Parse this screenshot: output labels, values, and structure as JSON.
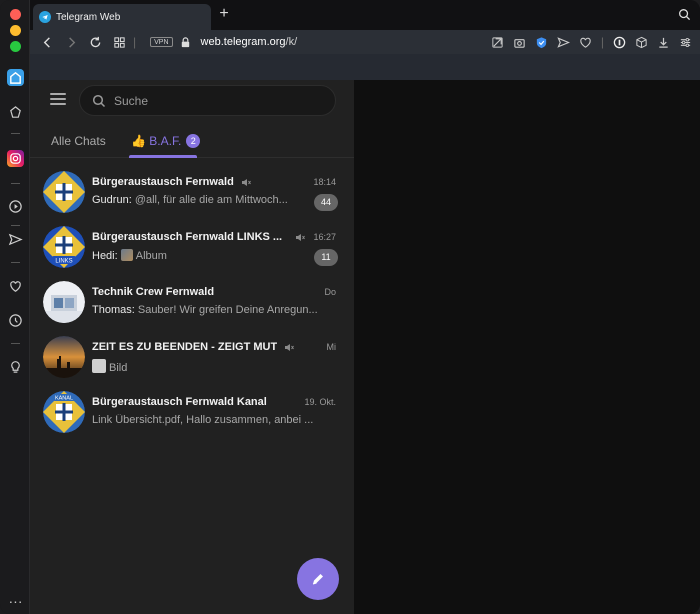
{
  "browser": {
    "tab_title": "Telegram Web",
    "new_tab_label": "+",
    "vpn_label": "VPN",
    "url_host": "web.telegram.org",
    "url_path": "/k/"
  },
  "search": {
    "placeholder": "Suche"
  },
  "folders": {
    "all_chats": "Alle Chats",
    "baf_label": "👍 B.A.F.",
    "baf_count": "2"
  },
  "chats": [
    {
      "name": "Bürgeraustausch Fernwald",
      "time": "18:14",
      "sender": "Gudrun: ",
      "text": "@all, für alle die am Mittwoch...",
      "count": "44",
      "muted": true
    },
    {
      "name": "Bürgeraustausch Fernwald LINKS ...",
      "time": "16:27",
      "sender": "Hedi: ",
      "text": "Album",
      "count": "11",
      "muted": true
    },
    {
      "name": "Technik Crew Fernwald",
      "time": "Do",
      "sender": "Thomas: ",
      "text": "Sauber! Wir greifen Deine Anregun...",
      "count": "",
      "muted": false
    },
    {
      "name": "ZEIT ES ZU BEENDEN - ZEIGT MUT",
      "time": "Mi",
      "sender": "",
      "text": "Bild",
      "count": "",
      "muted": true
    },
    {
      "name": "Bürgeraustausch Fernwald Kanal",
      "time": "19. Okt.",
      "sender": "",
      "text": "Link Übersicht.pdf, Hallo zusammen, anbei ...",
      "count": "",
      "muted": false
    }
  ],
  "avatar_labels": {
    "links": "LINKS",
    "kanal": "KANAL"
  },
  "colors": {
    "accent": "#8774e1",
    "panel": "#212121",
    "badge_muted": "#666666"
  }
}
